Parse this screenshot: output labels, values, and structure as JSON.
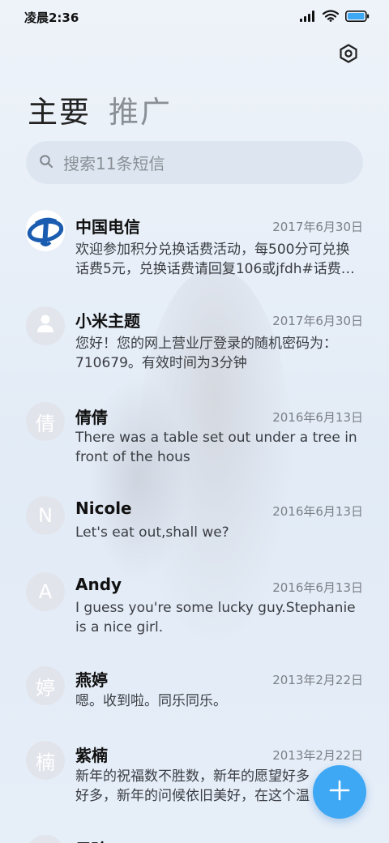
{
  "status_bar": {
    "time": "凌晨2:36",
    "icons": [
      "signal-icon",
      "wifi-icon",
      "battery-icon"
    ]
  },
  "header": {
    "settings_icon": "settings-icon"
  },
  "tabs": [
    {
      "label": "主要",
      "active": true
    },
    {
      "label": "推广",
      "active": false
    }
  ],
  "search": {
    "placeholder": "搜索11条短信"
  },
  "conversations": [
    {
      "name": "中国电信",
      "date": "2017年6月30日",
      "preview": "欢迎参加积分兑换话费活动，每500分可兑换话费5元，兑换话费请回复106或jfdh#话费…",
      "avatar": "china-telecom-logo"
    },
    {
      "name": "小米主题",
      "date": "2017年6月30日",
      "preview": "您好！您的网上营业厅登录的随机密码为：710679。有效时间为3分钟",
      "avatar": "person-icon"
    },
    {
      "name": "倩倩",
      "date": "2016年6月13日",
      "preview": "There was a table set out under a tree in front of the hous",
      "avatar_text": "倩"
    },
    {
      "name": "Nicole",
      "date": "2016年6月13日",
      "preview": "Let's eat out,shall we?",
      "avatar_text": "N"
    },
    {
      "name": "Andy",
      "date": "2016年6月13日",
      "preview": "I guess you're some lucky guy.Stephanie is a nice girl.",
      "avatar_text": "A"
    },
    {
      "name": "燕婷",
      "date": "2013年2月22日",
      "preview": "嗯。收到啦。同乐同乐。",
      "avatar_text": "婷"
    },
    {
      "name": "紫楠",
      "date": "2013年2月22日",
      "preview": "新年的祝福数不胜数，新年的愿望好多好多，新年的问候依旧美好，在这个温馨的时刻",
      "avatar_text": "楠"
    },
    {
      "name": "子玲",
      "date": "",
      "preview": "",
      "avatar_text": ""
    }
  ],
  "fab": {
    "icon": "plus-icon"
  },
  "colors": {
    "accent": "#3fa8f4",
    "telecom_blue": "#1a5cb0"
  }
}
